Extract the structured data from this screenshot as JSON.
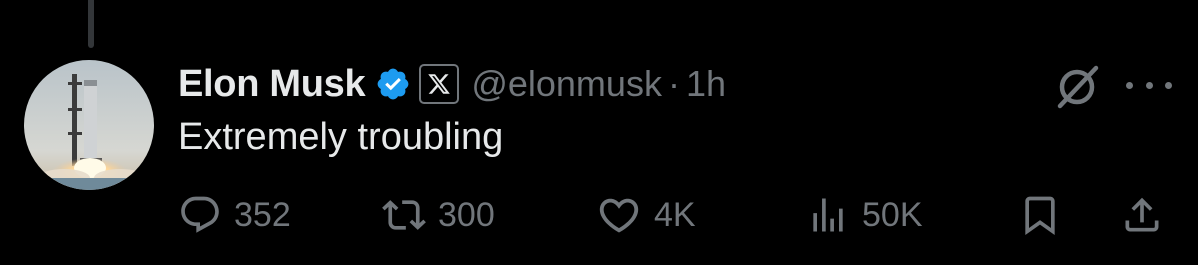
{
  "tweet": {
    "author_name": "Elon Musk",
    "handle": "@elonmusk",
    "separator": "·",
    "time": "1h",
    "text": "Extremely troubling"
  },
  "icons": {
    "verified": "verified-badge-icon",
    "affiliate": "x-logo-icon",
    "grok": "grok-icon",
    "more": "more-icon",
    "reply": "reply-icon",
    "repost": "repost-icon",
    "like": "like-icon",
    "views": "views-icon",
    "bookmark": "bookmark-icon",
    "share": "share-icon"
  },
  "stats": {
    "replies": "352",
    "reposts": "300",
    "likes": "4K",
    "views": "50K"
  },
  "colors": {
    "background": "#000000",
    "primary_text": "#e7e9ea",
    "secondary_text": "#71767b",
    "verified_blue": "#1d9bf0"
  }
}
